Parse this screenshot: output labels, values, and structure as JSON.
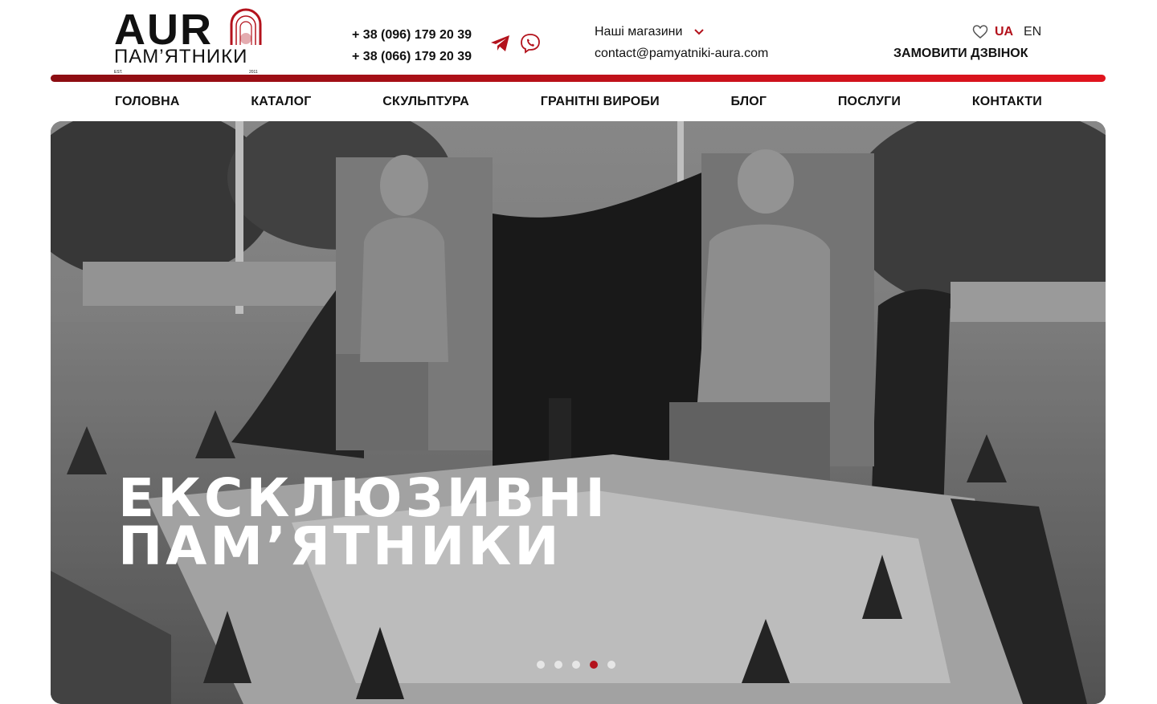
{
  "brand": {
    "logo_word": "AUR",
    "logo_sub": "ПАМ’ЯТНИКИ",
    "logo_est": "EST.",
    "logo_year": "2011"
  },
  "contacts": {
    "phone_1": "+ 38 (096) 179 20 39",
    "phone_2": "+ 38 (066) 179 20 39",
    "shops_label": "Наші магазини",
    "email": "contact@pamyatniki-aura.com"
  },
  "header_right": {
    "lang_ua": "UA",
    "lang_en": "EN",
    "order_call": "ЗАМОВИТИ ДЗВІНОК"
  },
  "nav": {
    "items": [
      {
        "label": "ГОЛОВНА"
      },
      {
        "label": "КАТАЛОГ"
      },
      {
        "label": "СКУЛЬПТУРА"
      },
      {
        "label": "ГРАНІТНІ ВИРОБИ"
      },
      {
        "label": "БЛОГ"
      },
      {
        "label": "ПОСЛУГИ"
      },
      {
        "label": "КОНТАКТИ"
      }
    ]
  },
  "hero": {
    "title_line_1": "ЕКСКЛЮЗИВНІ",
    "title_line_2": "ПАМ’ЯТНИКИ",
    "slide_count": 5,
    "active_slide": 4
  },
  "icons": {
    "telegram": "telegram-icon",
    "viber": "viber-icon",
    "chevron": "chevron-down-icon",
    "heart": "heart-icon"
  },
  "colors": {
    "accent": "#b3121c",
    "bar_start": "#8c0d12",
    "bar_end": "#e0141e"
  }
}
